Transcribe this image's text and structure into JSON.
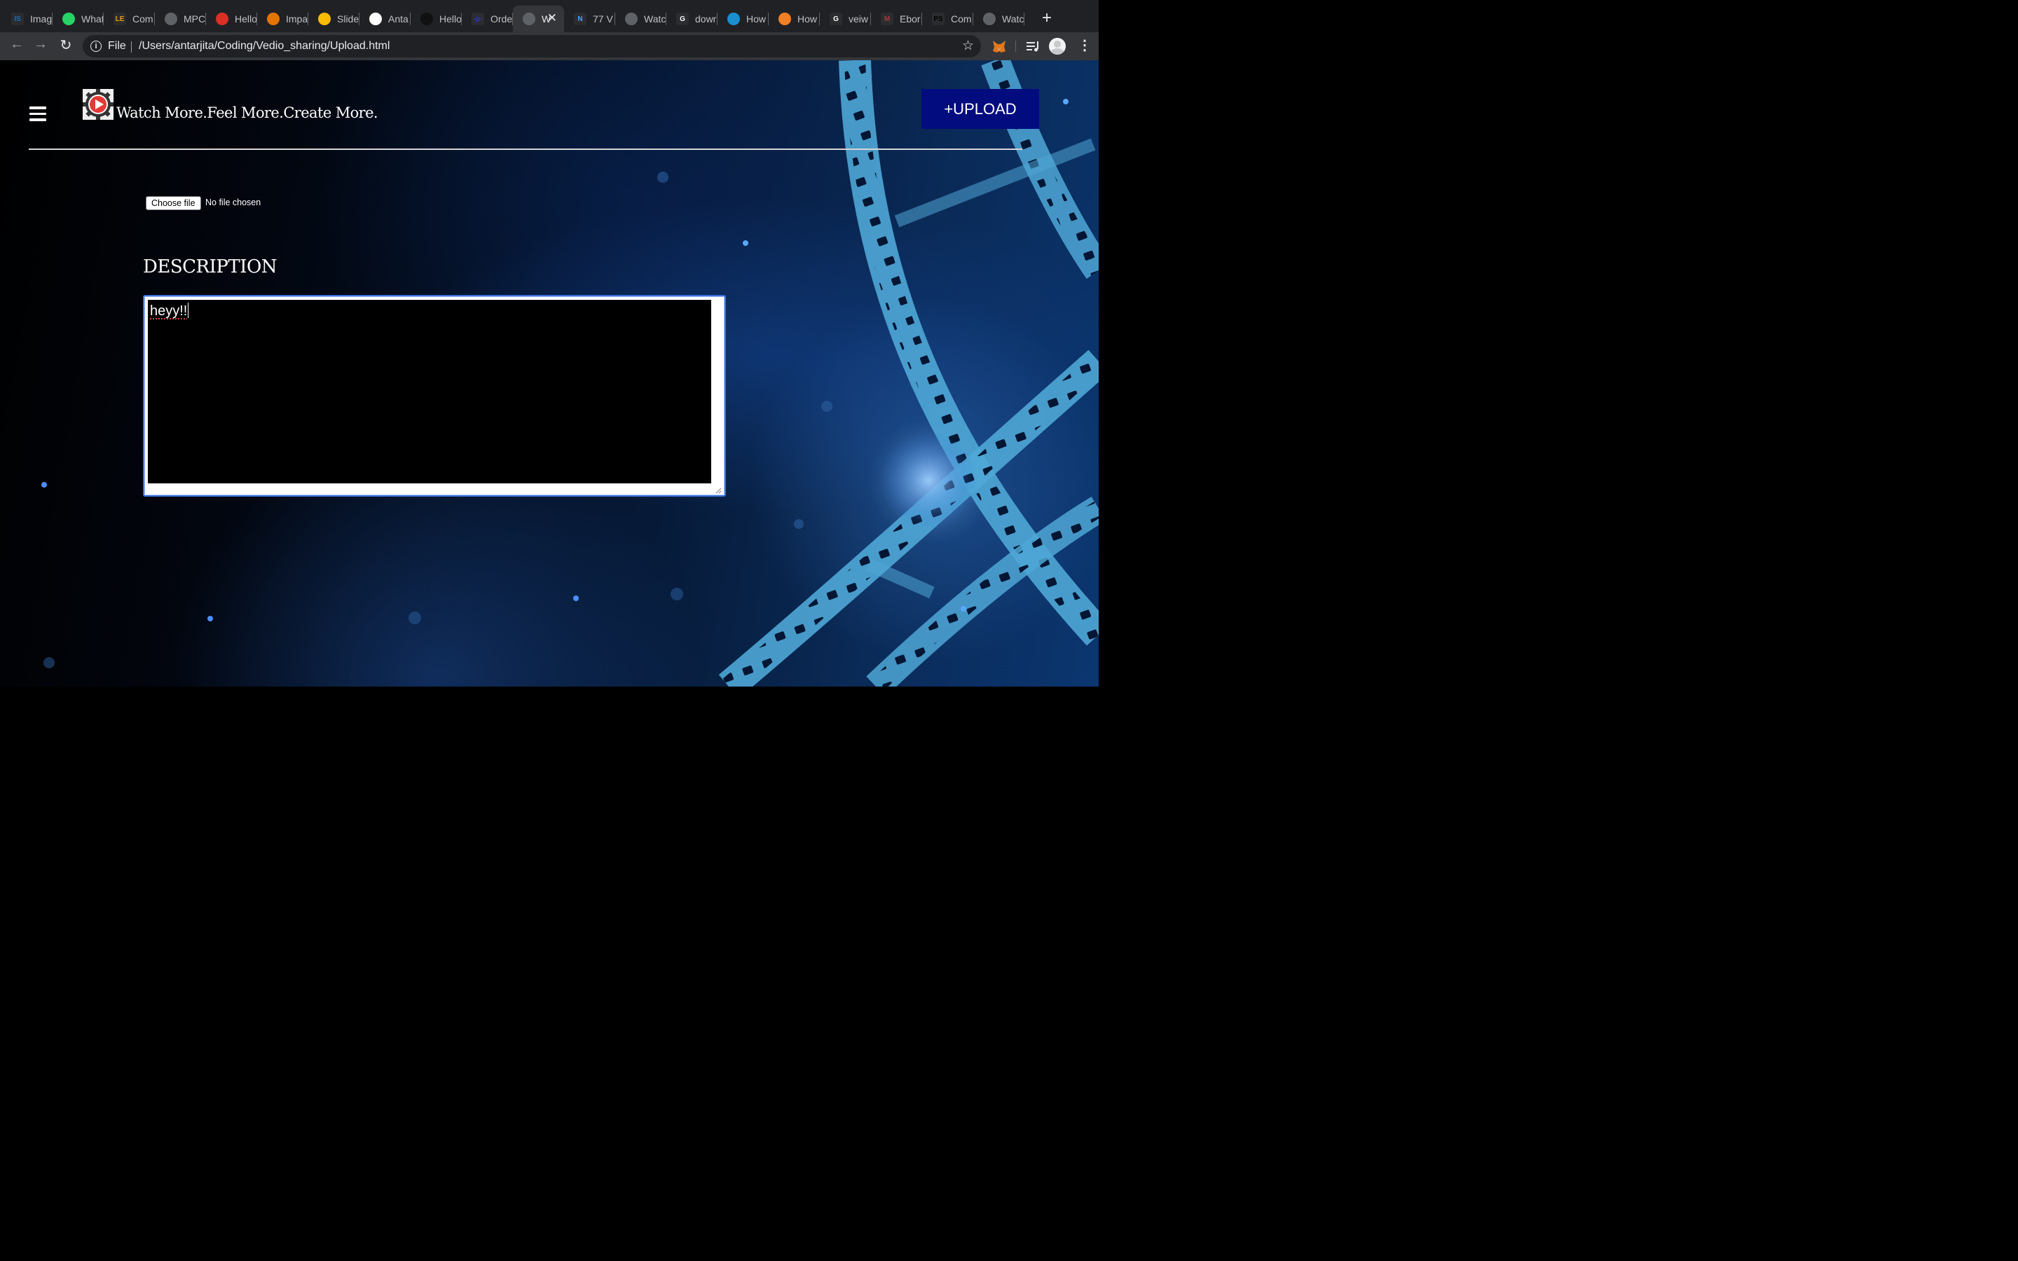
{
  "browser": {
    "tabs": [
      {
        "title": "Imag",
        "favicon": "IS",
        "fav_color": "#1b6fc2"
      },
      {
        "title": "What",
        "favicon": "whatsapp-icon",
        "fav_color": "#25d366"
      },
      {
        "title": "Com",
        "favicon": "LE",
        "fav_color": "#e89a1c"
      },
      {
        "title": "MPC",
        "favicon": "globe-icon",
        "fav_color": "#5f6368"
      },
      {
        "title": "Hello",
        "favicon": "gmail-icon",
        "fav_color": "#d93025"
      },
      {
        "title": "Impa",
        "favicon": "asterisk-icon",
        "fav_color": "#e37400"
      },
      {
        "title": "Slide",
        "favicon": "drive-icon",
        "fav_color": "#fbbc04"
      },
      {
        "title": "Anta",
        "favicon": "github-icon",
        "fav_color": "#ffffff"
      },
      {
        "title": "Hello",
        "favicon": "github-icon",
        "fav_color": "#111111"
      },
      {
        "title": "Orde",
        "favicon": "-p-",
        "fav_color": "#2a3eb1"
      },
      {
        "title": "W",
        "favicon": "globe-icon",
        "fav_color": "#5f6368"
      },
      {
        "title": "77 V",
        "favicon": "N",
        "fav_color": "#4aa3ff"
      },
      {
        "title": "Watc",
        "favicon": "globe-icon",
        "fav_color": "#5f6368"
      },
      {
        "title": "dowr",
        "favicon": "G",
        "fav_color": "#ffffff"
      },
      {
        "title": "How",
        "favicon": "gear-icon",
        "fav_color": "#1a8fd0"
      },
      {
        "title": "How",
        "favicon": "stack-icon",
        "fav_color": "#f48024"
      },
      {
        "title": "veiw",
        "favicon": "G",
        "fav_color": "#ffffff"
      },
      {
        "title": "Ebor",
        "favicon": "M",
        "fav_color": "#a73a3a"
      },
      {
        "title": "Com",
        "favicon": "PS",
        "fav_color": "#000000"
      },
      {
        "title": "Watc",
        "favicon": "globe-icon",
        "fav_color": "#5f6368"
      }
    ],
    "scheme_label": "File",
    "url": "/Users/antarjita/Coding/Vedio_sharing/Upload.html"
  },
  "header": {
    "tagline": "Watch More.Feel More.Create More.",
    "upload_label": "+UPLOAD"
  },
  "form": {
    "file_button_label": "Choose file",
    "file_status": "No file chosen",
    "description_heading": "DESCRIPTION",
    "description_value": "heyy!!"
  },
  "colors": {
    "upload_button": "#030c7f",
    "textarea_focus": "#3a6fdc"
  }
}
